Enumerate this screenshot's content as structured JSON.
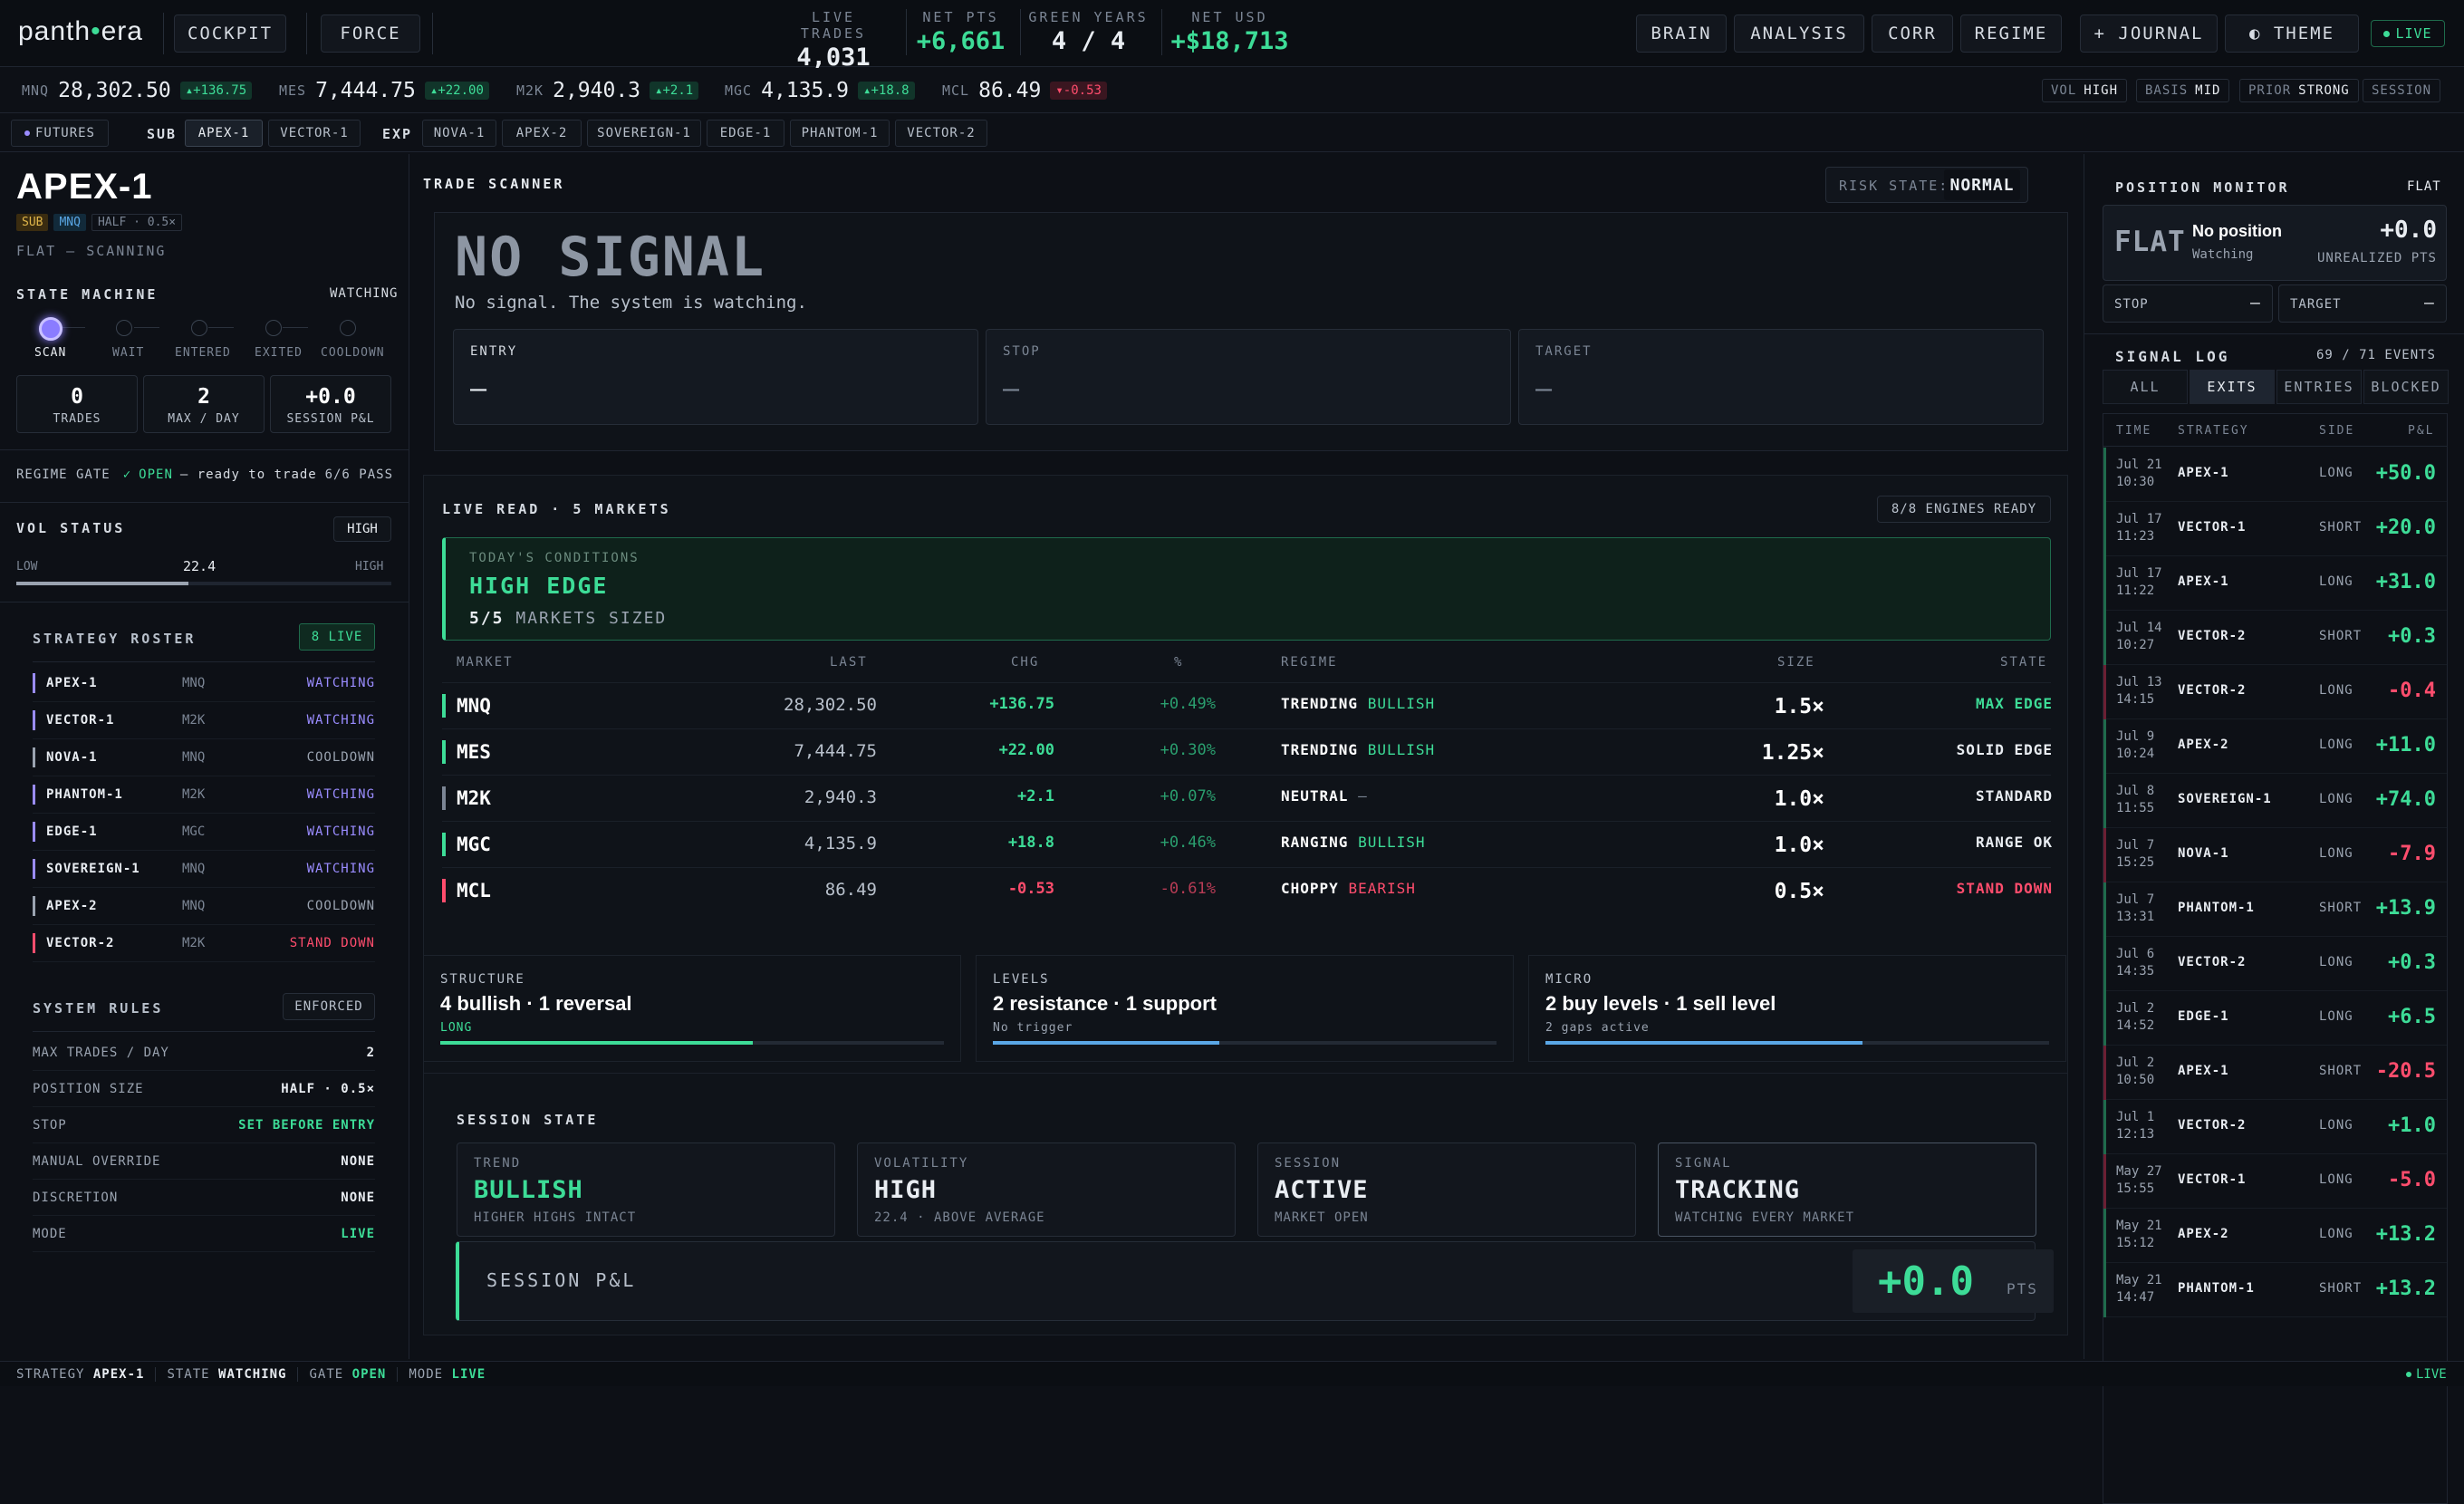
{
  "topbar": {
    "logo_left": "panth",
    "logo_dot": "•",
    "logo_right": "era",
    "cockpit": "COCKPIT",
    "force": "FORCE",
    "stats": [
      {
        "label": "LIVE TRADES",
        "value": "4,031"
      },
      {
        "label": "NET PTS",
        "value": "+6,661"
      },
      {
        "label": "GREEN YEARS",
        "value": "4 / 4"
      },
      {
        "label": "NET USD",
        "value": "+$18,713"
      }
    ],
    "nav": [
      "BRAIN",
      "ANALYSIS",
      "CORR",
      "REGIME",
      "+ JOURNAL",
      "◐ THEME"
    ],
    "live": "LIVE",
    "accent": "#3ddc97",
    "negative": "#ff4d6d"
  },
  "ticker": [
    {
      "sym": "MNQ",
      "price": "28,302.50",
      "chg": "+136.75",
      "dir": "up"
    },
    {
      "sym": "MES",
      "price": "7,444.75",
      "chg": "+22.00",
      "dir": "up"
    },
    {
      "sym": "M2K",
      "price": "2,940.3",
      "chg": "+2.1",
      "dir": "up"
    },
    {
      "sym": "MGC",
      "price": "4,135.9",
      "chg": "+18.8",
      "dir": "up"
    },
    {
      "sym": "MCL",
      "price": "86.49",
      "chg": "-0.53",
      "dir": "down"
    }
  ],
  "indicators": [
    {
      "k": "VOL",
      "v": "HIGH"
    },
    {
      "k": "BASIS",
      "v": "MID"
    },
    {
      "k": "PRIOR",
      "v": "STRONG"
    },
    {
      "k": "SESSION",
      "v": ""
    }
  ],
  "subbar": {
    "futures": "FUTURES",
    "sub_label": "SUB",
    "sub_items": [
      "APEX-1",
      "VECTOR-1"
    ],
    "exp_label": "EXP",
    "exp_items": [
      "NOVA-1",
      "APEX-2",
      "SOVEREIGN-1",
      "EDGE-1",
      "PHANTOM-1",
      "VECTOR-2"
    ]
  },
  "left": {
    "title": "APEX-1",
    "tags": [
      "SUB",
      "MNQ",
      "HALF · 0.5×"
    ],
    "status": "FLAT — SCANNING",
    "state_machine_label": "STATE MACHINE",
    "state_machine_value": "WATCHING",
    "states": [
      "SCAN",
      "WAIT",
      "ENTERED",
      "EXITED",
      "COOLDOWN"
    ],
    "counters": [
      {
        "v": "0",
        "l": "TRADES"
      },
      {
        "v": "2",
        "l": "MAX / DAY"
      },
      {
        "v": "+0.0",
        "l": "SESSION P&L"
      }
    ],
    "gate_label": "REGIME GATE",
    "gate_check": "✓",
    "gate_open": "OPEN",
    "gate_text": "— ready to trade",
    "gate_pass": "6/6 PASS",
    "vol_label": "VOL STATUS",
    "vol_badge": "HIGH",
    "vol_low": "LOW",
    "vol_value": "22.4",
    "vol_high": "HIGH",
    "vol_fill": 0.46,
    "roster_label": "STRATEGY ROSTER",
    "roster_badge": "8 LIVE",
    "roster": [
      {
        "name": "APEX-1",
        "mkt": "MNQ",
        "state": "WATCHING",
        "color": "#9a8cff"
      },
      {
        "name": "VECTOR-1",
        "mkt": "M2K",
        "state": "WATCHING",
        "color": "#9a8cff"
      },
      {
        "name": "NOVA-1",
        "mkt": "MNQ",
        "state": "COOLDOWN",
        "color": "#9aa3b0"
      },
      {
        "name": "PHANTOM-1",
        "mkt": "M2K",
        "state": "WATCHING",
        "color": "#9a8cff"
      },
      {
        "name": "EDGE-1",
        "mkt": "MGC",
        "state": "WATCHING",
        "color": "#9a8cff"
      },
      {
        "name": "SOVEREIGN-1",
        "mkt": "MNQ",
        "state": "WATCHING",
        "color": "#9a8cff"
      },
      {
        "name": "APEX-2",
        "mkt": "MNQ",
        "state": "COOLDOWN",
        "color": "#9aa3b0"
      },
      {
        "name": "VECTOR-2",
        "mkt": "M2K",
        "state": "STAND DOWN",
        "color": "#ff4d6d"
      }
    ],
    "rules_label": "SYSTEM RULES",
    "rules_badge": "ENFORCED",
    "rules": [
      {
        "k": "MAX TRADES / DAY",
        "v": "2",
        "color": "#e9edf2"
      },
      {
        "k": "POSITION SIZE",
        "v": "HALF · 0.5×",
        "color": "#e9edf2"
      },
      {
        "k": "STOP",
        "v": "SET BEFORE ENTRY",
        "color": "#3ddc97"
      },
      {
        "k": "MANUAL OVERRIDE",
        "v": "NONE",
        "color": "#e9edf2"
      },
      {
        "k": "DISCRETION",
        "v": "NONE",
        "color": "#e9edf2"
      },
      {
        "k": "MODE",
        "v": "LIVE",
        "color": "#3ddc97"
      }
    ]
  },
  "scanner": {
    "title": "TRADE SCANNER",
    "risk_label": "RISK STATE:",
    "risk_value": "NORMAL",
    "headline": "NO SIGNAL",
    "subline": "No signal. The system is watching.",
    "boxes": [
      {
        "label": "ENTRY",
        "value": "—"
      },
      {
        "label": "STOP",
        "value": "—"
      },
      {
        "label": "TARGET",
        "value": "—"
      }
    ]
  },
  "liveread": {
    "title": "LIVE READ · 5 MARKETS",
    "engines": "8/8 ENGINES READY",
    "cond_label": "TODAY'S CONDITIONS",
    "cond_value": "HIGH EDGE",
    "cond_sized_n": "5/5",
    "cond_sized_t": "MARKETS SIZED",
    "columns": [
      "MARKET",
      "LAST",
      "CHG",
      "%",
      "REGIME",
      "SIZE",
      "STATE"
    ],
    "rows": [
      {
        "mkt": "MNQ",
        "last": "28,302.50",
        "chg": "+136.75",
        "pct": "+0.49%",
        "reg": "TRENDING",
        "bias": "BULLISH",
        "size": "1.5×",
        "state": "MAX EDGE",
        "color": "#3ddc97",
        "dir": "up"
      },
      {
        "mkt": "MES",
        "last": "7,444.75",
        "chg": "+22.00",
        "pct": "+0.30%",
        "reg": "TRENDING",
        "bias": "BULLISH",
        "size": "1.25×",
        "state": "SOLID EDGE",
        "color": "#e9edf2",
        "dir": "up"
      },
      {
        "mkt": "M2K",
        "last": "2,940.3",
        "chg": "+2.1",
        "pct": "+0.07%",
        "reg": "NEUTRAL",
        "bias": "—",
        "size": "1.0×",
        "state": "STANDARD",
        "color": "#e9edf2",
        "dir": "up"
      },
      {
        "mkt": "MGC",
        "last": "4,135.9",
        "chg": "+18.8",
        "pct": "+0.46%",
        "reg": "RANGING",
        "bias": "BULLISH",
        "size": "1.0×",
        "state": "RANGE OK",
        "color": "#e9edf2",
        "dir": "up"
      },
      {
        "mkt": "MCL",
        "last": "86.49",
        "chg": "-0.53",
        "pct": "-0.61%",
        "reg": "CHOPPY",
        "bias": "BEARISH",
        "size": "0.5×",
        "state": "STAND DOWN",
        "color": "#ff4d6d",
        "dir": "down"
      }
    ]
  },
  "engines": [
    {
      "label": "STRUCTURE",
      "value": "4 bullish · 1 reversal",
      "sub": "LONG",
      "fill": 0.62,
      "color": "#3ddc97"
    },
    {
      "label": "LEVELS",
      "value": "2 resistance · 1 support",
      "sub": "No trigger",
      "fill": 0.45,
      "color": "#5aa7e6"
    },
    {
      "label": "MICRO",
      "value": "2 buy levels · 1 sell level",
      "sub": "2 gaps active",
      "fill": 0.63,
      "color": "#5aa7e6"
    }
  ],
  "session": {
    "title": "SESSION STATE",
    "cards": [
      {
        "label": "TREND",
        "value": "BULLISH",
        "sub": "HIGHER HIGHS INTACT",
        "color": "#3ddc97"
      },
      {
        "label": "VOLATILITY",
        "value": "HIGH",
        "sub": "22.4 · ABOVE AVERAGE",
        "color": "#e9edf2"
      },
      {
        "label": "SESSION",
        "value": "ACTIVE",
        "sub": "MARKET OPEN",
        "color": "#e9edf2"
      },
      {
        "label": "SIGNAL",
        "value": "TRACKING",
        "sub": "WATCHING EVERY MARKET",
        "color": "#e9edf2"
      }
    ],
    "pnl_label": "SESSION P&L",
    "pnl_value": "+0.0",
    "pnl_unit": "PTS"
  },
  "right": {
    "pos_title": "POSITION MONITOR",
    "pos_state": "FLAT",
    "pos_big": "FLAT",
    "pos_name": "No position",
    "pos_sub": "Watching",
    "pos_pnl": "+0.0",
    "pos_pnl_label": "UNREALIZED PTS",
    "stop_label": "STOP",
    "stop_value": "—",
    "target_label": "TARGET",
    "target_value": "—",
    "log_title": "SIGNAL LOG",
    "log_count": "69 / 71 EVENTS",
    "tabs": [
      "ALL",
      "EXITS",
      "ENTRIES",
      "BLOCKED"
    ],
    "columns": [
      "TIME",
      "STRATEGY",
      "SIDE",
      "P&L"
    ],
    "rows": [
      {
        "d": "Jul 21",
        "t": "10:30",
        "s": "APEX-1",
        "side": "LONG",
        "pl": "+50.0",
        "dir": "up"
      },
      {
        "d": "Jul 17",
        "t": "11:23",
        "s": "VECTOR-1",
        "side": "SHORT",
        "pl": "+20.0",
        "dir": "up"
      },
      {
        "d": "Jul 17",
        "t": "11:22",
        "s": "APEX-1",
        "side": "LONG",
        "pl": "+31.0",
        "dir": "up"
      },
      {
        "d": "Jul 14",
        "t": "10:27",
        "s": "VECTOR-2",
        "side": "SHORT",
        "pl": "+0.3",
        "dir": "up"
      },
      {
        "d": "Jul 13",
        "t": "14:15",
        "s": "VECTOR-2",
        "side": "LONG",
        "pl": "-0.4",
        "dir": "down"
      },
      {
        "d": "Jul 9",
        "t": "10:24",
        "s": "APEX-2",
        "side": "LONG",
        "pl": "+11.0",
        "dir": "up"
      },
      {
        "d": "Jul 8",
        "t": "11:55",
        "s": "SOVEREIGN-1",
        "side": "LONG",
        "pl": "+74.0",
        "dir": "up"
      },
      {
        "d": "Jul 7",
        "t": "15:25",
        "s": "NOVA-1",
        "side": "LONG",
        "pl": "-7.9",
        "dir": "down"
      },
      {
        "d": "Jul 7",
        "t": "13:31",
        "s": "PHANTOM-1",
        "side": "SHORT",
        "pl": "+13.9",
        "dir": "up"
      },
      {
        "d": "Jul 6",
        "t": "14:35",
        "s": "VECTOR-2",
        "side": "LONG",
        "pl": "+0.3",
        "dir": "up"
      },
      {
        "d": "Jul 2",
        "t": "14:52",
        "s": "EDGE-1",
        "side": "LONG",
        "pl": "+6.5",
        "dir": "up"
      },
      {
        "d": "Jul 2",
        "t": "10:50",
        "s": "APEX-1",
        "side": "SHORT",
        "pl": "-20.5",
        "dir": "down"
      },
      {
        "d": "Jul 1",
        "t": "12:13",
        "s": "VECTOR-2",
        "side": "LONG",
        "pl": "+1.0",
        "dir": "up"
      },
      {
        "d": "May 27",
        "t": "15:55",
        "s": "VECTOR-1",
        "side": "LONG",
        "pl": "-5.0",
        "dir": "down"
      },
      {
        "d": "May 21",
        "t": "15:12",
        "s": "APEX-2",
        "side": "LONG",
        "pl": "+13.2",
        "dir": "up"
      },
      {
        "d": "May 21",
        "t": "14:47",
        "s": "PHANTOM-1",
        "side": "SHORT",
        "pl": "+13.2",
        "dir": "up"
      }
    ]
  },
  "statusbar": {
    "items": [
      {
        "k": "STRATEGY",
        "v": "APEX-1",
        "color": "#e9edf2"
      },
      {
        "k": "STATE",
        "v": "WATCHING",
        "color": "#e9edf2"
      },
      {
        "k": "GATE",
        "v": "OPEN",
        "color": "#3ddc97"
      },
      {
        "k": "MODE",
        "v": "LIVE",
        "color": "#3ddc97"
      }
    ],
    "live": "LIVE"
  }
}
